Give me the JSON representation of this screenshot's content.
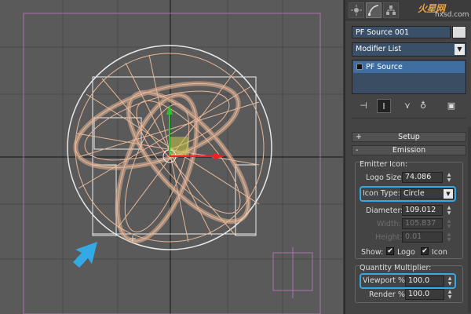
{
  "brand": {
    "logo": "火星网",
    "url": "hxsd.com"
  },
  "object_name": "PF Source 001",
  "modifier_list": "Modifier List",
  "stack_item": "PF Source",
  "rollouts": {
    "setup": "Setup",
    "setup_sign": "+",
    "emission": "Emission",
    "emission_sign": "-"
  },
  "emitter": {
    "group_label": "Emitter Icon:",
    "logo_size_label": "Logo Size:",
    "logo_size_value": "74.086",
    "icon_type_label": "Icon Type:",
    "icon_type_value": "Circle",
    "diameter_label": "Diameter:",
    "diameter_value": "109.012",
    "width_label": "Width:",
    "width_value": "105.837",
    "height_label": "Height:",
    "height_value": "0.01",
    "show_label": "Show:",
    "show_logo_label": "Logo",
    "show_icon_label": "Icon",
    "show_logo_checked": "✔",
    "show_icon_checked": "✔"
  },
  "quantity": {
    "group_label": "Quantity Multiplier:",
    "viewport_label": "Viewport %",
    "viewport_value": "100.0",
    "render_label": "Render %",
    "render_value": "100.0"
  },
  "colors": {
    "accent": "#35a8e6",
    "wire": "#e8b898",
    "frame": "#b070b0",
    "pf_blue": "#3f6fa0"
  },
  "icons": {
    "arrow": "arrow-pointer-icon"
  }
}
